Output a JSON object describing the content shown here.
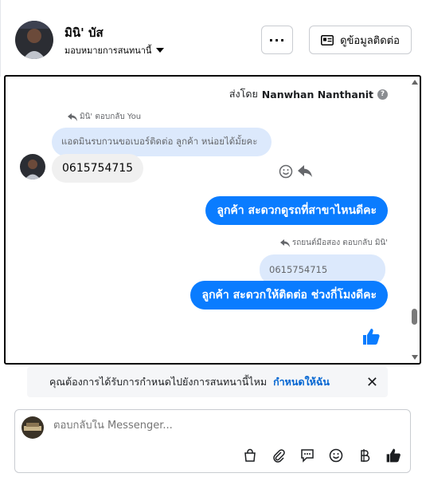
{
  "header": {
    "contact_name": "มินิ' บัส",
    "assign_label": "มอบหมายการสนทนานี้",
    "more_label": "···",
    "info_button_label": "ดูข้อมูลติดต่อ"
  },
  "chat": {
    "sent_by_prefix": "ส่งโดย",
    "sent_by_name": "Nanwhan Nanthanit",
    "help_glyph": "?",
    "messages": [
      {
        "reply_label": "มินิ' ตอบกลับ You",
        "quoted_text": "แอดมินรบกวนขอเบอร์ติดต่อ ลูกค้า หน่อยได้มั้ยคะ",
        "text": "0615754715"
      },
      {
        "text": "ลูกค้า สะดวกดูรถที่สาขาไหนดีคะ"
      },
      {
        "reply_label": "รถยนต์มือสอง ตอบกลับ มินิ'",
        "quoted_text": "0615754715",
        "text": "ลูกค้า สะดวกให้ติดต่อ ช่วงกี่โมงดีคะ"
      }
    ]
  },
  "reminder": {
    "text": "คุณต้องการได้รับการกำหนดไปยังการสนทนานี้ไหม",
    "link": "กำหนดให้ฉัน",
    "close": "✕"
  },
  "composer": {
    "placeholder": "ตอบกลับใน Messenger..."
  },
  "colors": {
    "accent": "#0a7cff",
    "quoted_bg": "#dce9fc",
    "incoming_bg": "#f0f0f0"
  }
}
